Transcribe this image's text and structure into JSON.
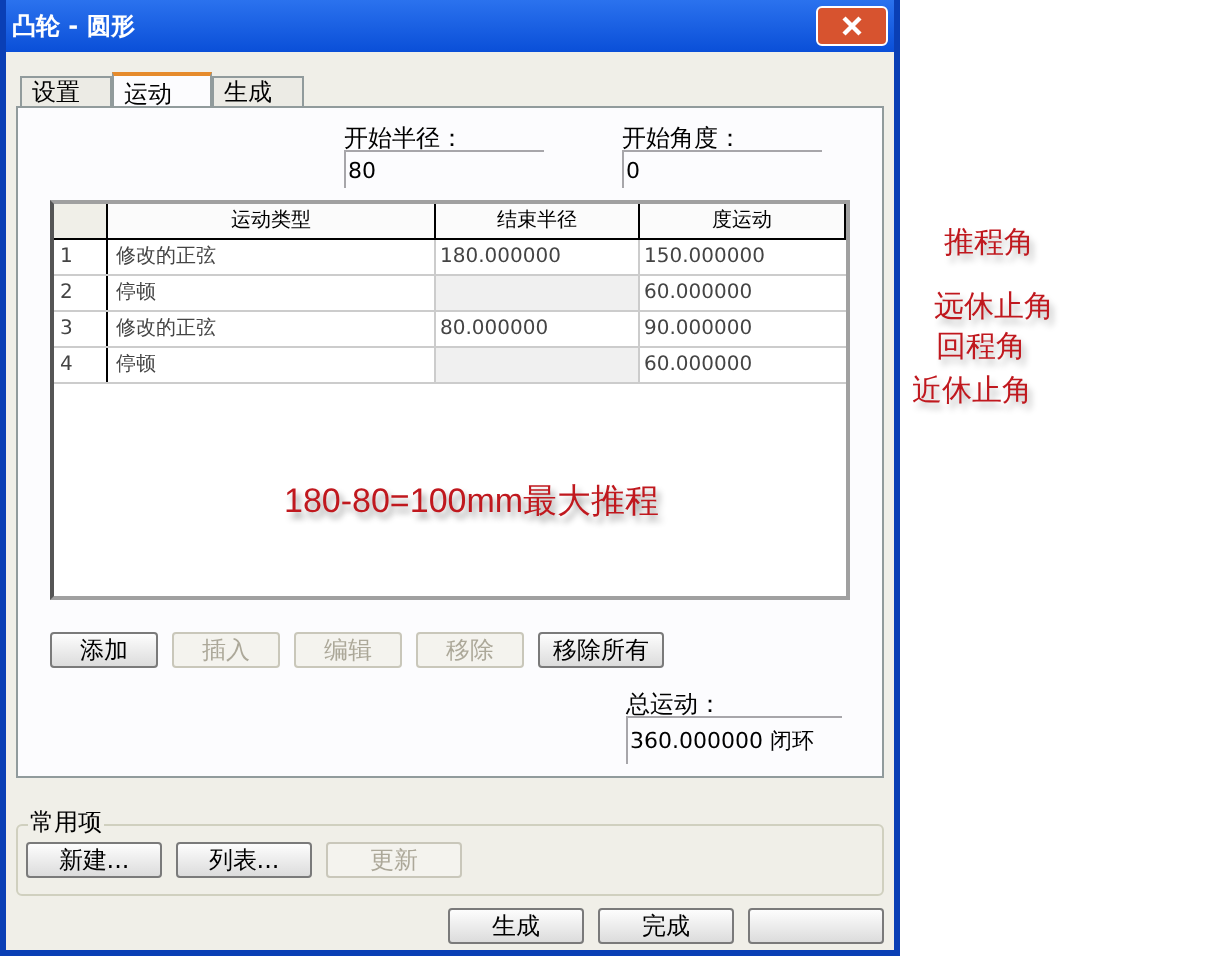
{
  "window": {
    "title": "凸轮 - 圆形"
  },
  "tabs": [
    {
      "label": "设置",
      "selected": false
    },
    {
      "label": "运动",
      "selected": true
    },
    {
      "label": "生成",
      "selected": false
    }
  ],
  "start_radius": {
    "label": "开始半径：",
    "value": "80"
  },
  "start_angle": {
    "label": "开始角度：",
    "value": "0"
  },
  "table": {
    "columns": [
      "运动类型",
      "结束半径",
      "度运动"
    ],
    "rows": [
      {
        "index": "1",
        "type": "修改的正弦",
        "end_radius": "180.000000",
        "degrees": "150.000000"
      },
      {
        "index": "2",
        "type": "停顿",
        "degrees": "60.000000"
      },
      {
        "index": "3",
        "type": "修改的正弦",
        "end_radius": "80.000000",
        "degrees": "90.000000"
      },
      {
        "index": "4",
        "type": "停顿",
        "degrees": "60.000000"
      }
    ]
  },
  "note": "180-80=100mm最大推程",
  "row_buttons": [
    {
      "label": "添加",
      "disabled": false
    },
    {
      "label": "插入",
      "disabled": true
    },
    {
      "label": "编辑",
      "disabled": true
    },
    {
      "label": "移除",
      "disabled": true
    },
    {
      "label": "移除所有",
      "disabled": false
    }
  ],
  "total_motion": {
    "label": "总运动：",
    "value": "360.000000 闭环"
  },
  "favorites": {
    "title": "常用项",
    "buttons": [
      {
        "label": "新建...",
        "disabled": false
      },
      {
        "label": "列表...",
        "disabled": false
      },
      {
        "label": "更新",
        "disabled": true
      }
    ]
  },
  "footer_buttons": [
    "生成",
    "完成"
  ],
  "annotations": [
    "推程角",
    "远休止角",
    "回程角",
    "近休止角"
  ]
}
